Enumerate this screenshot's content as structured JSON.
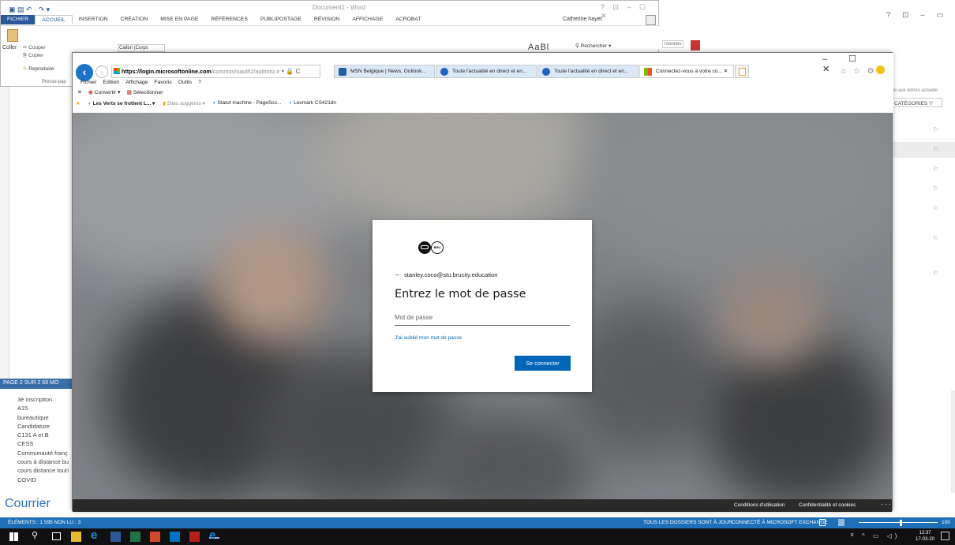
{
  "outlook": {
    "window_controls": "?  ⊡  –  ▭",
    "status_left": "PAGE 2 SUR 2   69 MO",
    "folders": [
      "3è inscription",
      "A15",
      "bureautique",
      "Candidature",
      "C131 A et B",
      "CESS",
      "Communauté franç",
      "cours à distance bu",
      "cours distance touri",
      "COVID"
    ],
    "courrier": "Courrier",
    "status_bar_left": "ÉLÉMENTS : 1 595   NON LU : 3",
    "status_bar_sync": "TOUS LES DOSSIERS SONT À JOUR.",
    "status_bar_exchange": "CONNECTÉ À MICROSOFT EXCHANGE",
    "zoom": "100",
    "right_search": "ite aux lettres actuelle",
    "right_categories": "CATÉGORIES"
  },
  "word": {
    "title": "Document1 - Word",
    "controls": "?  ⊡  –  ☐  ✕",
    "user": "Catherine hayet",
    "tabs": [
      "FICHIER",
      "ACCUEIL",
      "INSERTION",
      "CRÉATION",
      "MISE EN PAGE",
      "RÉFÉRENCES",
      "PUBLIPOSTAGE",
      "RÉVISION",
      "AFFICHAGE",
      "ACROBAT"
    ],
    "coller": "Coller",
    "couper": "Couper",
    "copier": "Copier",
    "reproduire": "Reproduire",
    "presse_papiers": "Presse-pap",
    "rechercher": "Rechercher",
    "font": "Calibri (Corps",
    "personnes": "rsonnes"
  },
  "ie": {
    "address_domain": "https://login.microsoftonline.com",
    "address_rest": "/common/oauth2/authorize?clien",
    "address_controls": "⌕ ▾ 🔒 C",
    "tabs": [
      {
        "label": "MSN Belgique | News, Outlook...",
        "color": "#2b6cb0"
      },
      {
        "label": "Toute l'actualité en direct et en...",
        "color": "#1e64c8"
      },
      {
        "label": "Toute l'actualité en direct et en...",
        "color": "#1e64c8"
      },
      {
        "label": "Connectez-vous à votre co...   ✕",
        "color": "#f25022"
      }
    ],
    "window_controls": "–  ☐  ✕",
    "menu": [
      "Fichier",
      "Edition",
      "Affichage",
      "Favoris",
      "Outils",
      "?"
    ],
    "commands": [
      "✕",
      "Convertir ▾",
      "Sélectionner"
    ],
    "favorites": {
      "fav1": "Les Verts se frottent L... ▾",
      "fav2": "Sites suggérés ▾",
      "fav3": "Statut machine - PageSco...",
      "fav4": "Lexmark CS421dn"
    },
    "footer_terms": "Conditions d'utilisation",
    "footer_privacy": "Confidentialité et cookies",
    "footer_more": "· · ·"
  },
  "signin": {
    "logo_text": "BRU",
    "back_arrow": "←",
    "email": "stanley.coco@stu.brucity.education",
    "title": "Entrez le mot de passe",
    "password_placeholder": "Mot de passe",
    "forgot_link": "J'ai oublié mon mot de passe",
    "submit": "Se connecter"
  },
  "taskbar": {
    "time": "12:37",
    "date": "17-03-20",
    "system": "ᴿ ^ ▭ ◁)"
  }
}
